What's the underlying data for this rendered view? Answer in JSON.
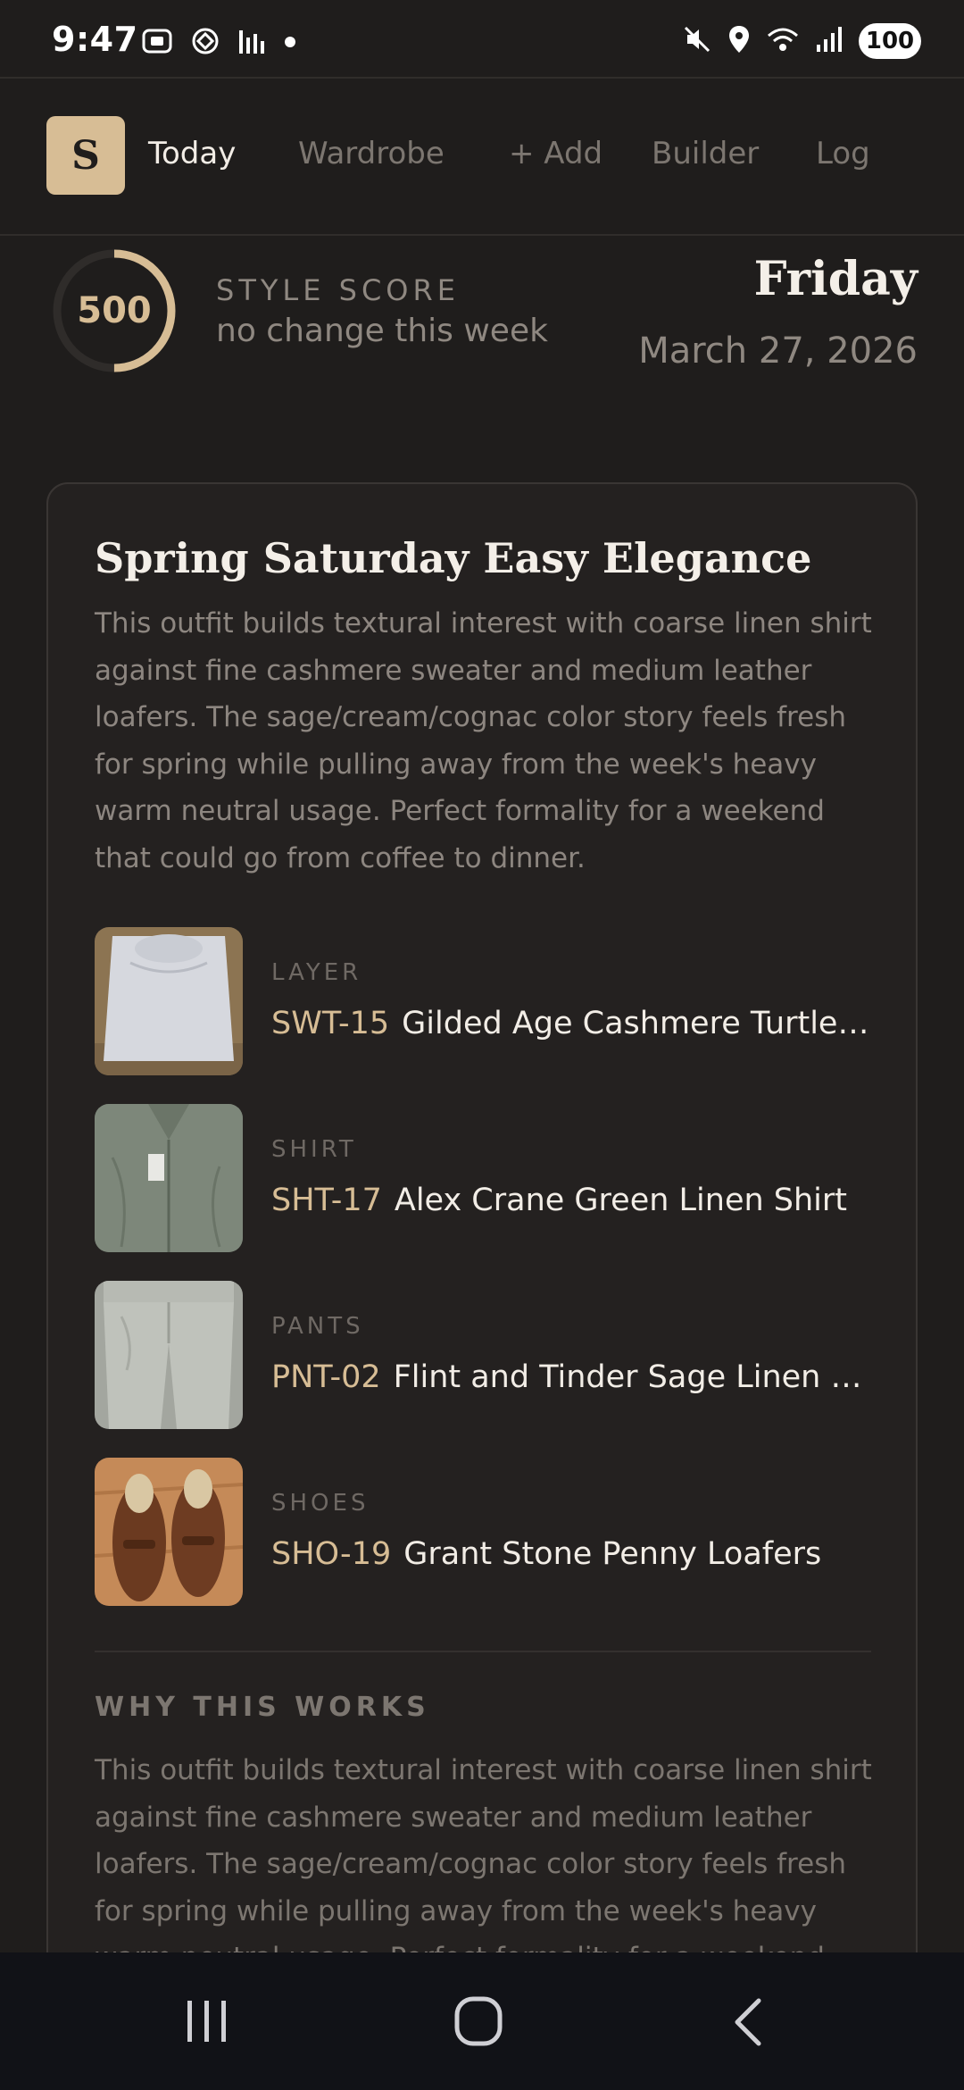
{
  "status_bar": {
    "time": "9:47",
    "battery": "100",
    "left_icons": [
      "screenshot-icon",
      "chatgpt-icon",
      "equalizer-icon",
      "dot-icon"
    ],
    "right_icons": [
      "mute-icon",
      "location-icon",
      "wifi-icon",
      "signal-icon"
    ]
  },
  "nav": {
    "logo_letter": "S",
    "items": [
      {
        "label": "Today",
        "active": true
      },
      {
        "label": "Wardrobe",
        "active": false
      },
      {
        "label": "+ Add",
        "active": false
      },
      {
        "label": "Builder",
        "active": false
      },
      {
        "label": "Log",
        "active": false
      }
    ]
  },
  "score": {
    "value": "500",
    "label": "STYLE SCORE",
    "change_text": "no change this week",
    "ring_fill": 0.5
  },
  "date": {
    "day": "Friday",
    "full_date": "March 27, 2026"
  },
  "outfit": {
    "title": "Spring Saturday Easy Elegance",
    "description": "This outfit builds textural interest with coarse linen shirt against fine cashmere sweater and medium leather loafers. The sage/cream/cognac color story feels fresh for spring while pulling away from the week's heavy warm neutral usage. Perfect formality for a weekend that could go from coffee to dinner.",
    "items": [
      {
        "category": "LAYER",
        "code": "SWT-15",
        "name": "Gilded Age Cashmere Turtleneck"
      },
      {
        "category": "SHIRT",
        "code": "SHT-17",
        "name": "Alex Crane Green Linen Shirt"
      },
      {
        "category": "PANTS",
        "code": "PNT-02",
        "name": "Flint and Tinder Sage Linen Trousers"
      },
      {
        "category": "SHOES",
        "code": "SHO-19",
        "name": "Grant Stone Penny Loafers"
      }
    ],
    "why_heading": "WHY THIS WORKS",
    "why_body": "This outfit builds textural interest with coarse linen shirt against fine cashmere sweater and medium leather loafers. The sage/cream/cognac color story feels fresh for spring while pulling away from the week's heavy warm neutral usage. Perfect formality for a weekend that could go from coffee to dinner."
  },
  "colors": {
    "background": "#1f1d1c",
    "card": "#242120",
    "accent": "#d7bd95",
    "muted_text": "#8d8680"
  }
}
